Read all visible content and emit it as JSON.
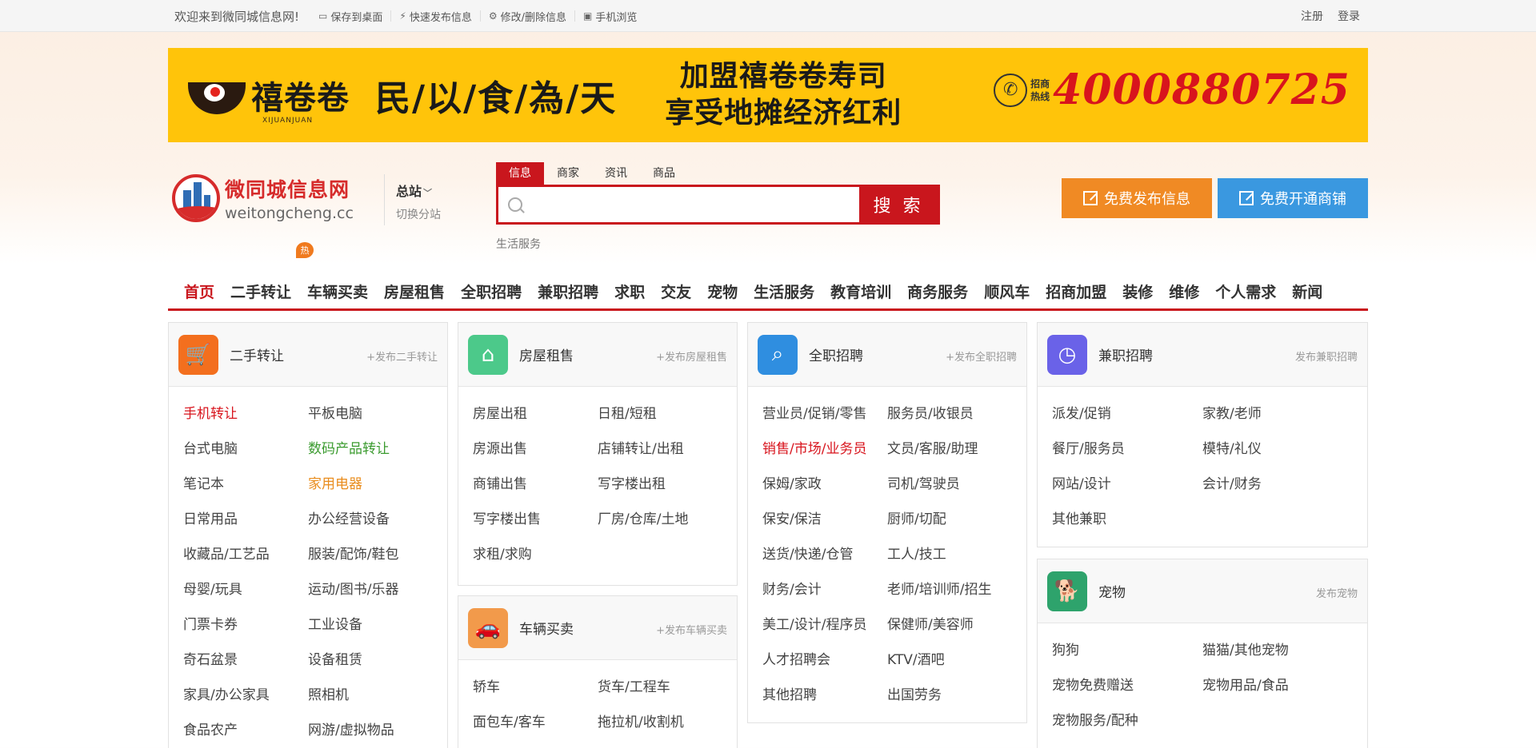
{
  "topbar": {
    "welcome": "欢迎来到微同城信息网!",
    "links": [
      {
        "icon": "monitor-icon",
        "label": "保存到桌面"
      },
      {
        "icon": "lightning-icon",
        "label": "快速发布信息"
      },
      {
        "icon": "gear-icon",
        "label": "修改/删除信息"
      },
      {
        "icon": "phone-icon",
        "label": "手机浏览"
      }
    ],
    "register": "注册",
    "login": "登录"
  },
  "banner": {
    "brand": "禧卷卷",
    "brand_sub": "XIJUANJUAN",
    "slogan": "民/以/食/為/天",
    "promo_line1": "加盟禧卷卷寿司",
    "promo_line2": "享受地摊经济红利",
    "hotline_label1": "招商",
    "hotline_label2": "热线",
    "hotline_number": "4000880725"
  },
  "site": {
    "name_cn": "微同城信息网",
    "name_en": "weitongcheng.cc",
    "station": "总站",
    "switch_station": "切换分站"
  },
  "search": {
    "tabs": [
      "信息",
      "商家",
      "资讯",
      "商品"
    ],
    "active_tab": 0,
    "placeholder": "",
    "button": "搜 索",
    "hint": "生活服务"
  },
  "actions": {
    "post_info": "免费发布信息",
    "open_shop": "免费开通商铺"
  },
  "nav": {
    "items": [
      "首页",
      "二手转让",
      "车辆买卖",
      "房屋租售",
      "全职招聘",
      "兼职招聘",
      "求职",
      "交友",
      "宠物",
      "生活服务",
      "教育培训",
      "商务服务",
      "顺风车",
      "招商加盟",
      "装修",
      "维修",
      "个人需求",
      "新闻"
    ],
    "active": 0,
    "hot_badge": "热"
  },
  "cards": {
    "secondhand": {
      "icon": "cart-icon",
      "color": "#f36f1e",
      "title": "二手转让",
      "post": "+发布二手转让",
      "links": [
        "手机转让",
        "平板电脑",
        "台式电脑",
        "数码产品转让",
        "笔记本",
        "家用电器",
        "日常用品",
        "办公经营设备",
        "收藏品/工艺品",
        "服装/配饰/鞋包",
        "母婴/玩具",
        "运动/图书/乐器",
        "门票卡券",
        "工业设备",
        "奇石盆景",
        "设备租赁",
        "家具/办公家具",
        "照相机",
        "食品农产",
        "网游/虚拟物品"
      ]
    },
    "housing": {
      "icon": "house-icon",
      "color": "#4cc98a",
      "title": "房屋租售",
      "post": "+发布房屋租售",
      "links": [
        "房屋出租",
        "日租/短租",
        "房源出售",
        "店铺转让/出租",
        "商铺出售",
        "写字楼出租",
        "写字楼出售",
        "厂房/仓库/土地",
        "求租/求购"
      ]
    },
    "vehicles": {
      "icon": "car-icon",
      "color": "#f29a4b",
      "title": "车辆买卖",
      "post": "+发布车辆买卖",
      "links": [
        "轿车",
        "货车/工程车",
        "面包车/客车",
        "拖拉机/收割机"
      ]
    },
    "fulltime": {
      "icon": "magnifier-icon",
      "color": "#2f8ee0",
      "title": "全职招聘",
      "post": "+发布全职招聘",
      "links": [
        "营业员/促销/零售",
        "服务员/收银员",
        "销售/市场/业务员",
        "文员/客服/助理",
        "保姆/家政",
        "司机/驾驶员",
        "保安/保洁",
        "厨师/切配",
        "送货/快递/仓管",
        "工人/技工",
        "财务/会计",
        "老师/培训师/招生",
        "美工/设计/程序员",
        "保健师/美容师",
        "人才招聘会",
        "KTV/酒吧",
        "其他招聘",
        "出国劳务"
      ]
    },
    "parttime": {
      "icon": "clock-icon",
      "color": "#6a62e8",
      "title": "兼职招聘",
      "post": "发布兼职招聘",
      "links": [
        "派发/促销",
        "家教/老师",
        "餐厅/服务员",
        "模特/礼仪",
        "网站/设计",
        "会计/财务",
        "其他兼职"
      ]
    },
    "pets": {
      "icon": "dog-icon",
      "color": "#2ea36c",
      "title": "宠物",
      "post": "发布宠物",
      "links": [
        "狗狗",
        "猫猫/其他宠物",
        "宠物免费赠送",
        "宠物用品/食品",
        "宠物服务/配种"
      ]
    }
  },
  "link_colors": {
    "red": "#d8141d",
    "green": "#3b9b2f",
    "orange": "#e98c1c"
  }
}
